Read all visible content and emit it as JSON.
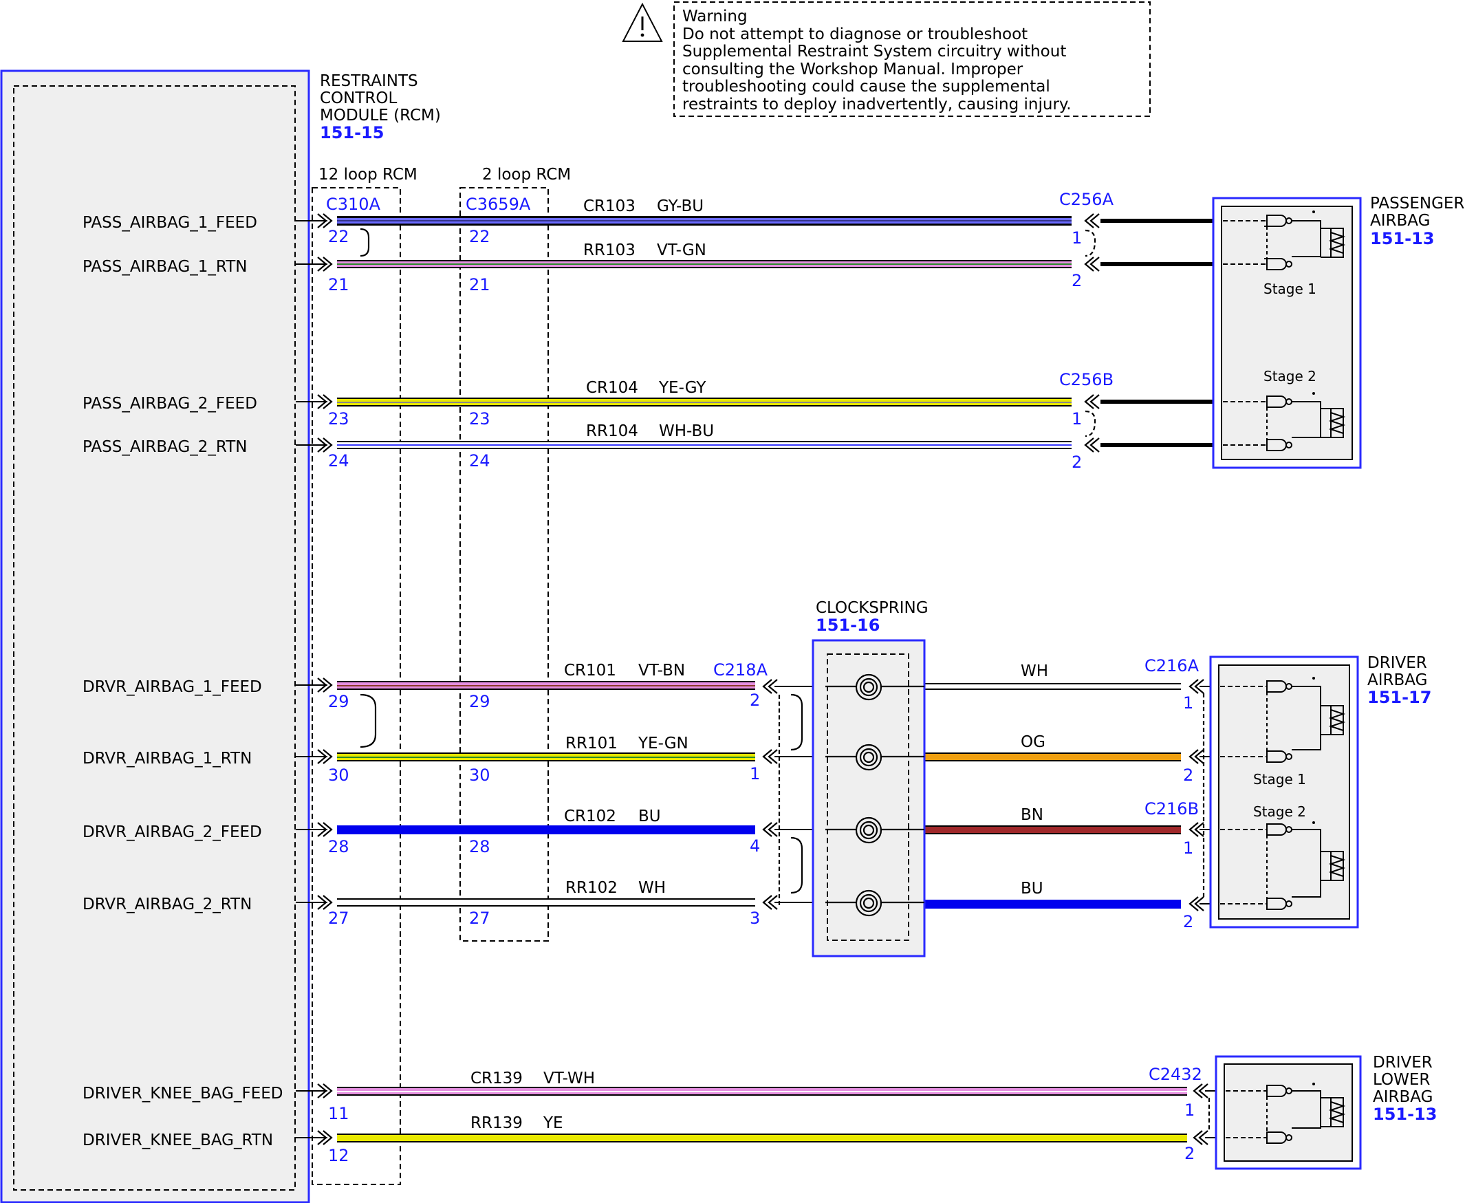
{
  "warning": {
    "title": "Warning",
    "lines": [
      "Do not attempt to diagnose or troubleshoot",
      "Supplemental Restraint System circuitry without",
      "consulting the Workshop Manual. Improper",
      "troubleshooting could cause the supplemental",
      "restraints to deploy inadvertently, causing injury."
    ]
  },
  "rcm": {
    "label_lines": [
      "RESTRAINTS",
      "CONTROL",
      "MODULE (RCM)"
    ],
    "ref": "151-15",
    "variant_12": "12 loop RCM",
    "variant_2": "2 loop RCM",
    "connector_12": "C310A",
    "connector_2": "C3659A"
  },
  "signals": [
    "PASS_AIRBAG_1_FEED",
    "PASS_AIRBAG_1_RTN",
    "PASS_AIRBAG_2_FEED",
    "PASS_AIRBAG_2_RTN",
    "DRVR_AIRBAG_1_FEED",
    "DRVR_AIRBAG_1_RTN",
    "DRVR_AIRBAG_2_FEED",
    "DRVR_AIRBAG_2_RTN",
    "DRIVER_KNEE_BAG_FEED",
    "DRIVER_KNEE_BAG_RTN"
  ],
  "pins_c310a": [
    "22",
    "21",
    "23",
    "24",
    "29",
    "30",
    "28",
    "27",
    "11",
    "12"
  ],
  "pins_c3659a": [
    "22",
    "21",
    "23",
    "24",
    "29",
    "30",
    "28",
    "27"
  ],
  "circuits": [
    {
      "circuit": "CR103",
      "color": "GY-BU"
    },
    {
      "circuit": "RR103",
      "color": "VT-GN"
    },
    {
      "circuit": "CR104",
      "color": "YE-GY"
    },
    {
      "circuit": "RR104",
      "color": "WH-BU"
    },
    {
      "circuit": "CR101",
      "color": "VT-BN"
    },
    {
      "circuit": "RR101",
      "color": "YE-GN"
    },
    {
      "circuit": "CR102",
      "color": "BU"
    },
    {
      "circuit": "RR102",
      "color": "WH"
    },
    {
      "circuit": "CR139",
      "color": "VT-WH"
    },
    {
      "circuit": "RR139",
      "color": "YE"
    }
  ],
  "passenger_airbag": {
    "label_lines": [
      "PASSENGER",
      "AIRBAG"
    ],
    "ref": "151-13",
    "connector_a": "C256A",
    "connector_b": "C256B",
    "pins_a": [
      "1",
      "2"
    ],
    "pins_b": [
      "1",
      "2"
    ],
    "stage1": "Stage 1",
    "stage2": "Stage 2"
  },
  "clockspring": {
    "label": "CLOCKSPRING",
    "ref": "151-16",
    "connector": "C218A",
    "pins": [
      "2",
      "1",
      "4",
      "3"
    ],
    "output_wires": [
      "WH",
      "OG",
      "BN",
      "BU"
    ]
  },
  "driver_airbag": {
    "label_lines": [
      "DRIVER",
      "AIRBAG"
    ],
    "ref": "151-17",
    "connector_a": "C216A",
    "connector_b": "C216B",
    "pins_a": [
      "1",
      "2"
    ],
    "pins_b": [
      "1",
      "2"
    ],
    "stage1": "Stage 1",
    "stage2": "Stage 2"
  },
  "driver_lower_airbag": {
    "label_lines": [
      "DRIVER",
      "LOWER",
      "AIRBAG"
    ],
    "ref": "151-13",
    "connector": "C2432",
    "pins": [
      "1",
      "2"
    ]
  },
  "colors": {
    "ref_blue": "#1a1aff",
    "module_border": "#2a2aff",
    "module_fill": "#efefef",
    "violet": "#e58fe0",
    "yellow": "#e8e800",
    "blue": "#0000ee",
    "orange": "#f0a010",
    "brown": "#a0282a"
  }
}
